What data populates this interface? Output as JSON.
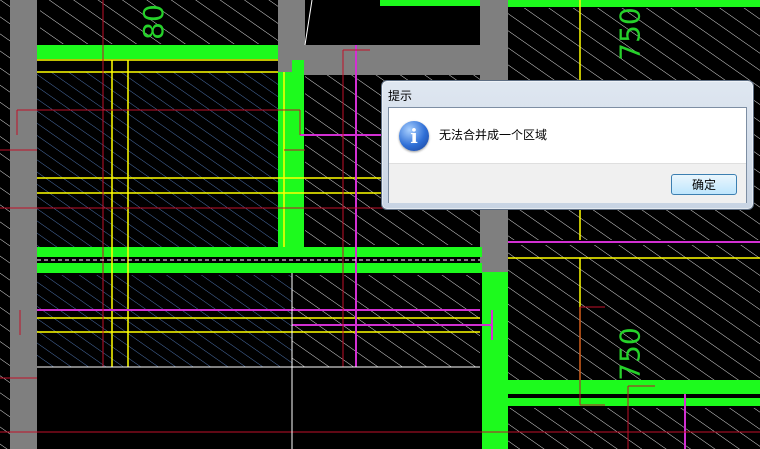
{
  "canvas": {
    "dimension_labels": [
      "80",
      "750",
      "750"
    ],
    "colors": {
      "background": "#000000",
      "wall_fill": "#7f7f7f",
      "green_band": "#1dfa1d",
      "hatch": "#d9d9d9",
      "yellow_line": "#ffff00",
      "magenta_line": "#d22fd2",
      "red_line": "#c0102a",
      "dim_text": "#26d12a"
    }
  },
  "dialog": {
    "title": "提示",
    "message": "无法合并成一个区域",
    "icon": "info-icon",
    "ok_label": "确定"
  }
}
